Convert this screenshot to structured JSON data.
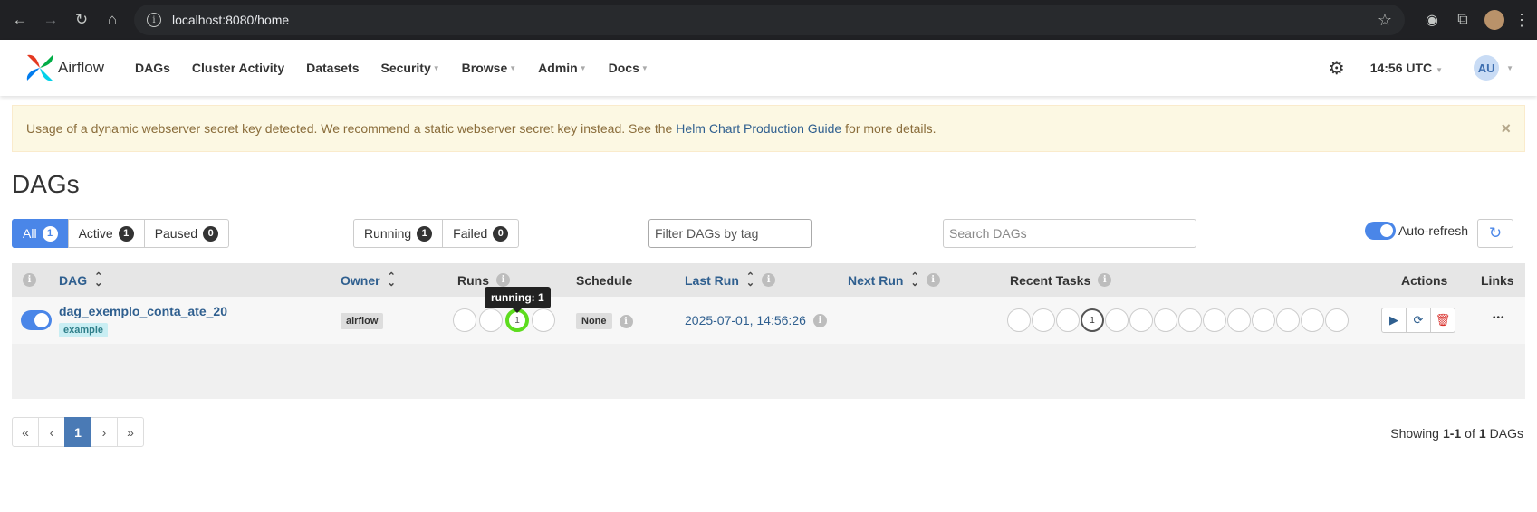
{
  "browser": {
    "url": "localhost:8080/home"
  },
  "navbar": {
    "brand": "Airflow",
    "items": [
      {
        "label": "DAGs",
        "caret": false
      },
      {
        "label": "Cluster Activity",
        "caret": false
      },
      {
        "label": "Datasets",
        "caret": false
      },
      {
        "label": "Security",
        "caret": true
      },
      {
        "label": "Browse",
        "caret": true
      },
      {
        "label": "Admin",
        "caret": true
      },
      {
        "label": "Docs",
        "caret": true
      }
    ],
    "time": "14:56 UTC",
    "avatar": "AU"
  },
  "alert": {
    "text_before": "Usage of a dynamic webserver secret key detected. We recommend a static webserver secret key instead. See the",
    "link": "Helm Chart Production Guide",
    "text_after": "for more details.",
    "close": "×"
  },
  "page": {
    "title": "DAGs"
  },
  "filters": {
    "status": [
      {
        "label": "All",
        "count": "1",
        "active": true
      },
      {
        "label": "Active",
        "count": "1",
        "active": false
      },
      {
        "label": "Paused",
        "count": "0",
        "active": false
      }
    ],
    "runs": [
      {
        "label": "Running",
        "count": "1"
      },
      {
        "label": "Failed",
        "count": "0"
      }
    ],
    "tag_placeholder": "Filter DAGs by tag",
    "search_placeholder": "Search DAGs",
    "auto_refresh": "Auto-refresh"
  },
  "table": {
    "headers": {
      "dag": "DAG",
      "owner": "Owner",
      "runs": "Runs",
      "schedule": "Schedule",
      "last_run": "Last Run",
      "next_run": "Next Run",
      "recent_tasks": "Recent Tasks",
      "actions": "Actions",
      "links": "Links"
    },
    "row": {
      "dag_id": "dag_exemplo_conta_ate_20",
      "tag": "example",
      "owner": "airflow",
      "schedule": "None",
      "last_run": "2025-07-01, 14:56:26",
      "runs_running_count": "1",
      "recent_tasks_count": "1",
      "links": "•••"
    },
    "tooltip": "running: 1"
  },
  "pagination": {
    "first": "«",
    "prev": "‹",
    "current": "1",
    "next": "›",
    "last": "»"
  },
  "showing": {
    "prefix": "Showing",
    "range": "1-1",
    "of": "of",
    "total": "1",
    "suffix": "DAGs"
  },
  "colors": {
    "primary": "#4a86e8",
    "running": "#5ddc1e",
    "link": "#2f5f8f",
    "alert_bg": "#fcf8e3"
  }
}
